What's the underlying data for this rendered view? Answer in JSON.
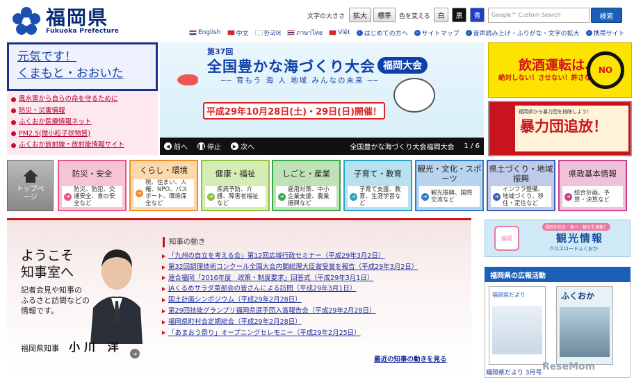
{
  "header": {
    "logo_ja": "福岡県",
    "logo_en": "Fukuoka Prefecture",
    "text_size_label": "文字の大きさ",
    "text_large": "拡大",
    "text_standard": "標準",
    "color_label": "色を変える",
    "color_white": "白",
    "color_black": "黒",
    "color_blue": "青",
    "search_placeholder": "Google™ Custom Search",
    "search_button": "検索",
    "languages": [
      "English",
      "中文",
      "한국어",
      "ภาษาไทย",
      "Việt"
    ],
    "links": [
      "はじめての方へ",
      "サイトマップ",
      "音声読み上げ・ふりがな・文字の拡大",
      "携帯サイト"
    ]
  },
  "genki": {
    "line1": "元気です！",
    "line2": "くまもと・おおいた"
  },
  "alerts": [
    "風水害から自らの命を守るために",
    "防災・災害情報",
    "ふくおか医療情報ネット",
    "PM2.5(微小粒子状物質)",
    "ふくおか放射線・放射能情報サイト"
  ],
  "banner": {
    "number": "第37回",
    "title": "全国豊かな海づくり大会",
    "badge": "福岡大会",
    "subtitle": "── 育もう 海 人 地域 みんなの未来 ──",
    "date": "平成29年10月28日(土)・29日(日)開催！",
    "prev": "前へ",
    "stop": "停止",
    "next": "次へ",
    "caption": "全国豊かな海づくり大会福岡大会",
    "counter": "1 / 6"
  },
  "right_banners": {
    "drink_title": "飲酒運転は、",
    "drink_sub": "絶対しない！させない！許さない！",
    "no_sign": "NO",
    "gang_sub": "福岡県から暴力団を排除しよう！",
    "gang_title": "暴力団追放！"
  },
  "nav": {
    "top": "トップページ",
    "categories": [
      {
        "title": "防災・安全",
        "desc": "防災、防犯、交通安全、食の安全など",
        "color": "#e8548a",
        "bg": "#f7c4d6"
      },
      {
        "title": "くらし・環境",
        "desc": "税、住まい、人権、NPO、パスポート、環境保全など",
        "color": "#f08c2a",
        "bg": "#fbd9ad"
      },
      {
        "title": "健康・福祉",
        "desc": "疾病予防、介護、障害者福祉など",
        "color": "#8cc043",
        "bg": "#d6ecb5"
      },
      {
        "title": "しごと・産業",
        "desc": "雇用対策、中小企業支援、農業振興など",
        "color": "#3aa84a",
        "bg": "#bfe3b6"
      },
      {
        "title": "子育て・教育",
        "desc": "子育て支援、教育、生涯学習など",
        "color": "#2aa0c8",
        "bg": "#b7e1ef"
      },
      {
        "title": "観光・文化・スポーツ",
        "desc": "観光振興、国際交流など",
        "color": "#2a7ec8",
        "bg": "#b9d4ee"
      },
      {
        "title": "県土づくり・地域振興",
        "desc": "インフラ整備、地域づくり、移住・定住など",
        "color": "#3d5fb8",
        "bg": "#c0cbe9"
      },
      {
        "title": "県政基本情報",
        "desc": "総合計画、予算・決算など",
        "color": "#c8408a",
        "bg": "#efc2da"
      }
    ]
  },
  "governor": {
    "welcome1": "ようこそ",
    "welcome2": "知事室へ",
    "sub1": "記者会見や知事の",
    "sub2": "ふるさと訪問などの",
    "sub3": "情報です。",
    "title": "福岡県知事",
    "name": "小川 洋",
    "news_heading": "知事の動き",
    "news": [
      "「九州の自立を考える会」第12回広域行政セミナー（平成29年3月2日）",
      "第32回調理技術コンクール全国大会内閣総理大臣賞受賞を報告（平成29年3月2日）",
      "連合福岡「2016年度　政策・制度要求」回答式（平成29年3月1日）",
      "JAくるめサラダ菜部会の皆さんによる訪問（平成29年3月1日）",
      "国土計画シンポジウム（平成29年2月28日）",
      "第29回技能グランプリ福岡県選手団入賞報告会（平成29年2月28日）",
      "福岡県町村会定期総会（平成29年2月28日）",
      "「あまおう祭り」オープニングセレモニー（平成29年2月25日）"
    ],
    "more": "最近の知事の動きを見る"
  },
  "side": {
    "kanko_tag": "福岡を知る・食べ・観るを満載！",
    "kanko_title": "観光情報",
    "kanko_sub": "クロスロードふくおか",
    "pr_heading": "福岡県の広報活動",
    "mag1_title": "福岡県だより",
    "mag2_title": "ふくおか",
    "mag_caption": "福岡県だより 3月号",
    "watermark": "ReseMom"
  }
}
